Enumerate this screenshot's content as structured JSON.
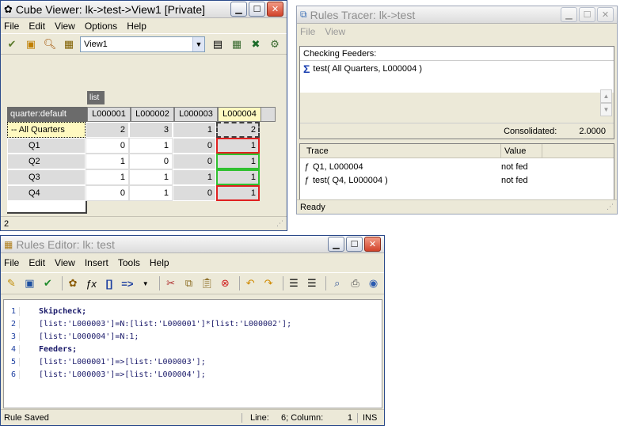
{
  "cube_viewer": {
    "title": "Cube Viewer: lk->test->View1  [Private]",
    "menu": [
      "File",
      "Edit",
      "View",
      "Options",
      "Help"
    ],
    "view_select": "View1",
    "column_dim": "list",
    "row_dim": "quarter:default",
    "columns": [
      "L000001",
      "L000002",
      "L000003",
      "L000004"
    ],
    "rows": [
      {
        "label": "-- All Quarters",
        "values": [
          "2",
          "3",
          "1",
          "2"
        ]
      },
      {
        "label": "Q1",
        "values": [
          "0",
          "1",
          "0",
          "1"
        ]
      },
      {
        "label": "Q2",
        "values": [
          "1",
          "0",
          "0",
          "1"
        ]
      },
      {
        "label": "Q3",
        "values": [
          "1",
          "1",
          "1",
          "1"
        ]
      },
      {
        "label": "Q4",
        "values": [
          "0",
          "1",
          "0",
          "1"
        ]
      }
    ],
    "status": "2"
  },
  "rules_tracer": {
    "title": "Rules Tracer: lk->test",
    "menu": [
      "File",
      "View"
    ],
    "checking_label": "Checking Feeders:",
    "checking_item": "test( All Quarters, L000004 )",
    "consolidated_label": "Consolidated:",
    "consolidated_value": "2.0000",
    "trace_header": "Trace",
    "value_header": "Value",
    "traces": [
      {
        "trace": "Q1, L000004",
        "value": "not fed"
      },
      {
        "trace": "test( Q4, L000004 )",
        "value": "not fed"
      }
    ],
    "status": "Ready"
  },
  "rules_editor": {
    "title": "Rules Editor: lk: test",
    "menu": [
      "File",
      "Edit",
      "View",
      "Insert",
      "Tools",
      "Help"
    ],
    "lines": [
      {
        "n": "1",
        "text": "Skipcheck;"
      },
      {
        "n": "2",
        "text": "[list:'L000003']=N:[list:'L000001']*[list:'L000002'];"
      },
      {
        "n": "3",
        "text": "[list:'L000004']=N:1;"
      },
      {
        "n": "4",
        "text": "Feeders;"
      },
      {
        "n": "5",
        "text": "[list:'L000001']=>[list:'L000003'];"
      },
      {
        "n": "6",
        "text": "[list:'L000003']=>[list:'L000004'];"
      }
    ],
    "status": "Rule Saved",
    "line_label": "Line:",
    "position": "6; Column:",
    "column": "1",
    "mode": "INS"
  }
}
